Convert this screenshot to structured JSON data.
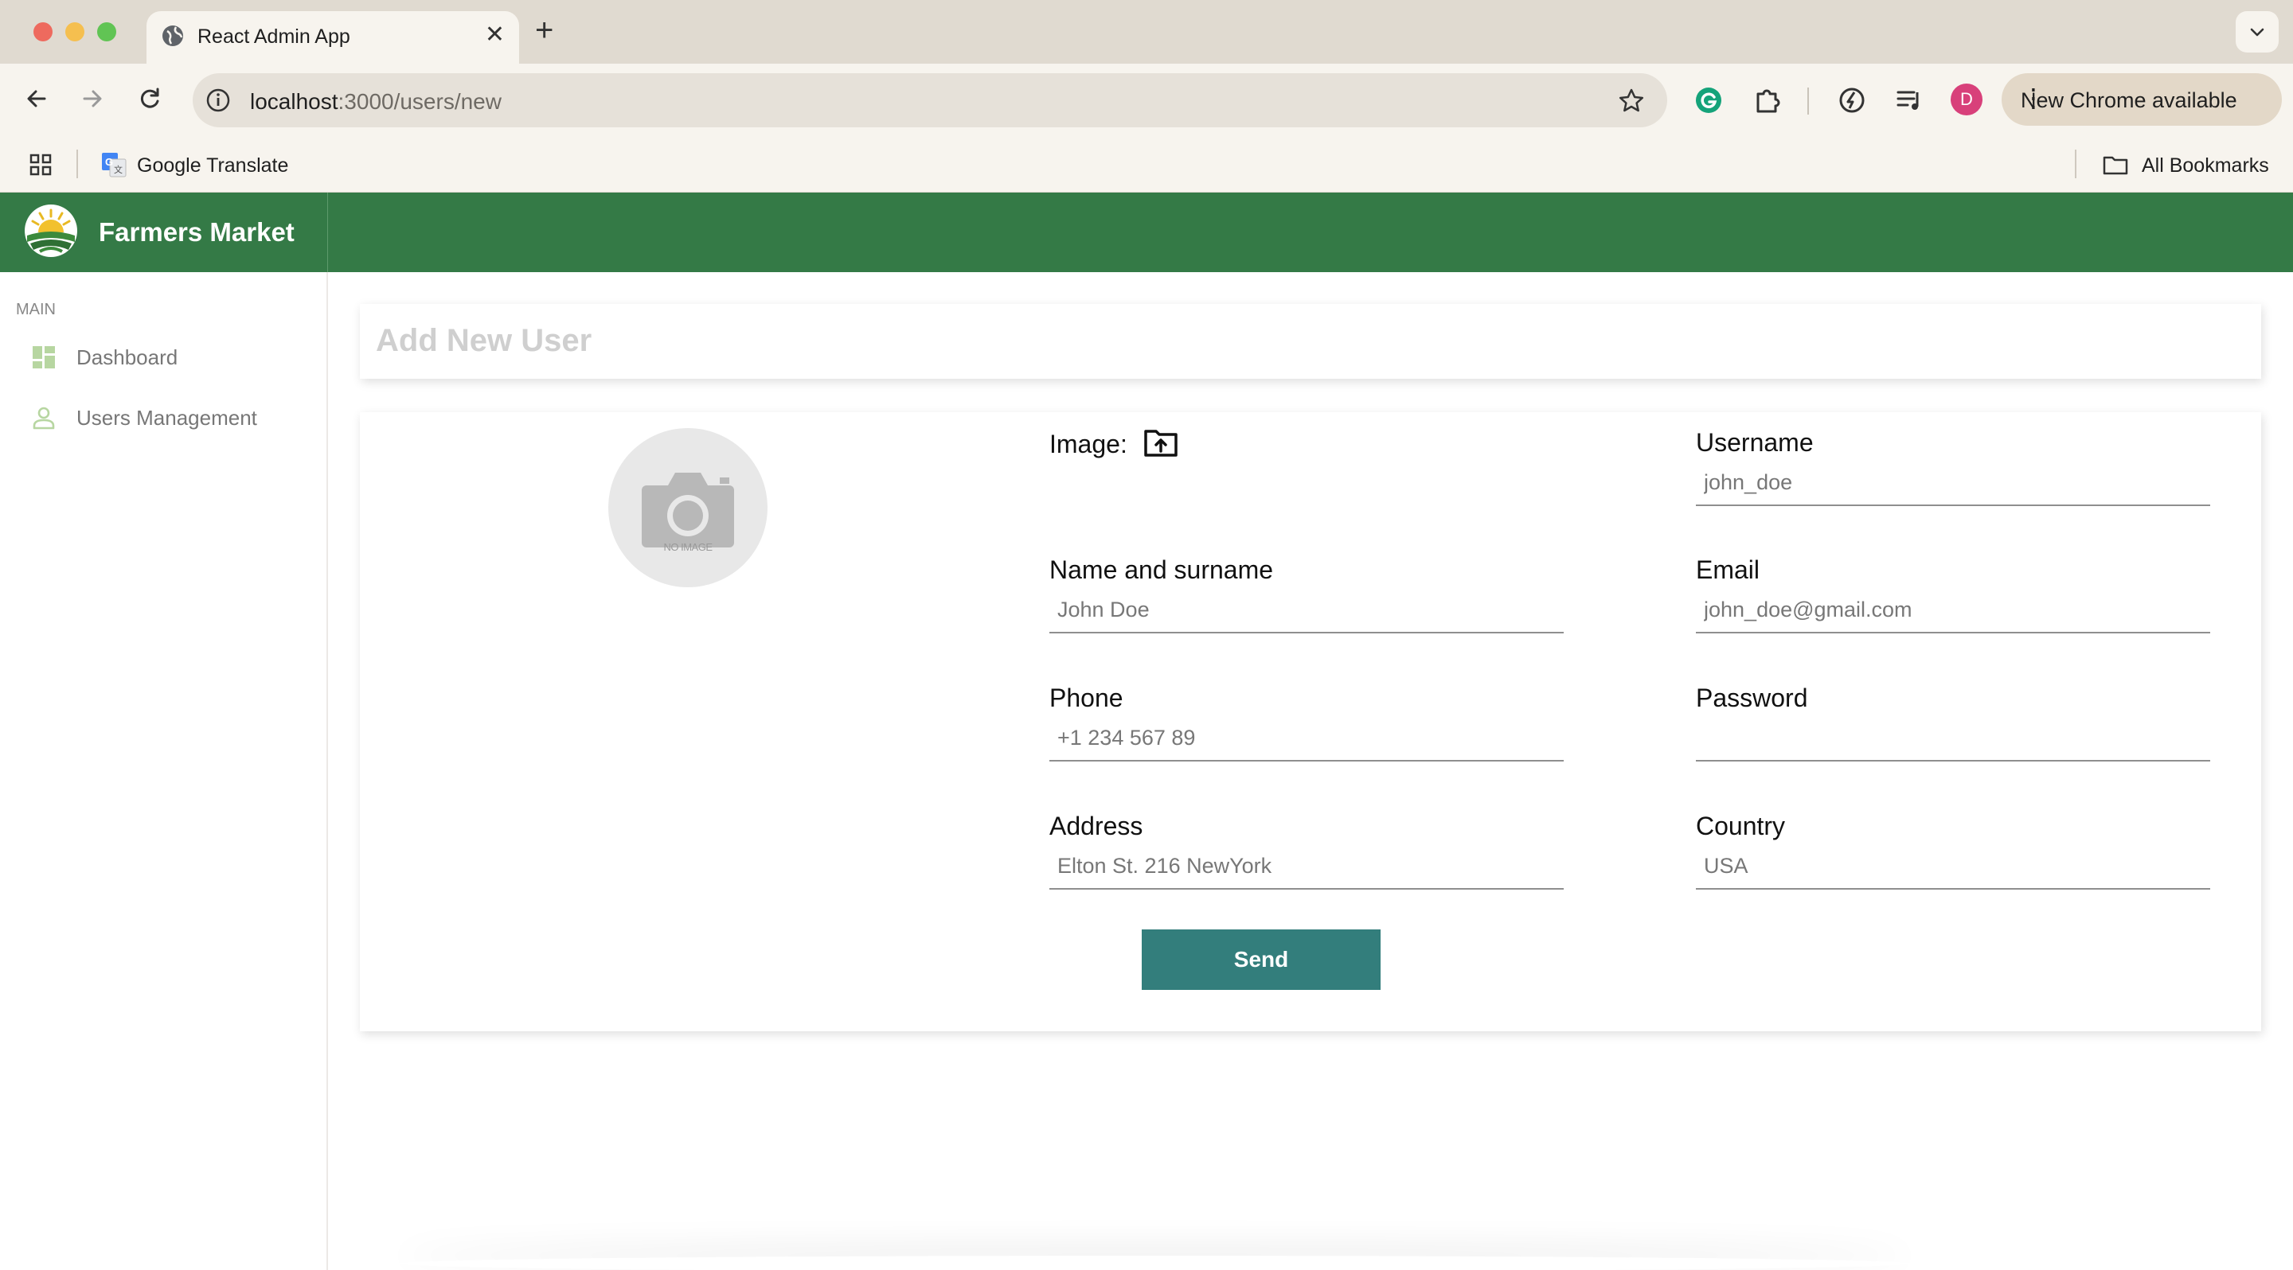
{
  "browser": {
    "tab_title": "React Admin App",
    "url_host": "localhost",
    "url_path": ":3000/users/new",
    "profile_initial": "D",
    "chrome_update": "New Chrome available",
    "bookmarks": [
      {
        "label": "Google Translate",
        "icon": "google-translate-icon"
      }
    ],
    "all_bookmarks": "All Bookmarks"
  },
  "app": {
    "brand": "Farmers Market",
    "brand_color": "#347a46",
    "sidebar": {
      "section": "MAIN",
      "items": [
        {
          "label": "Dashboard",
          "icon": "dashboard-icon"
        },
        {
          "label": "Users Management",
          "icon": "person-icon"
        }
      ]
    },
    "page_title": "Add New User",
    "form": {
      "avatar_text": "NO IMAGE",
      "image_label": "Image:",
      "fields": {
        "name": {
          "label": "Name and surname",
          "placeholder": "John Doe"
        },
        "phone": {
          "label": "Phone",
          "placeholder": "+1 234 567 89"
        },
        "address": {
          "label": "Address",
          "placeholder": "Elton St. 216 NewYork"
        },
        "username": {
          "label": "Username",
          "placeholder": "john_doe"
        },
        "email": {
          "label": "Email",
          "placeholder": "john_doe@gmail.com"
        },
        "password": {
          "label": "Password",
          "placeholder": ""
        },
        "country": {
          "label": "Country",
          "placeholder": "USA"
        }
      },
      "submit_label": "Send",
      "submit_color": "#337e7c"
    }
  }
}
